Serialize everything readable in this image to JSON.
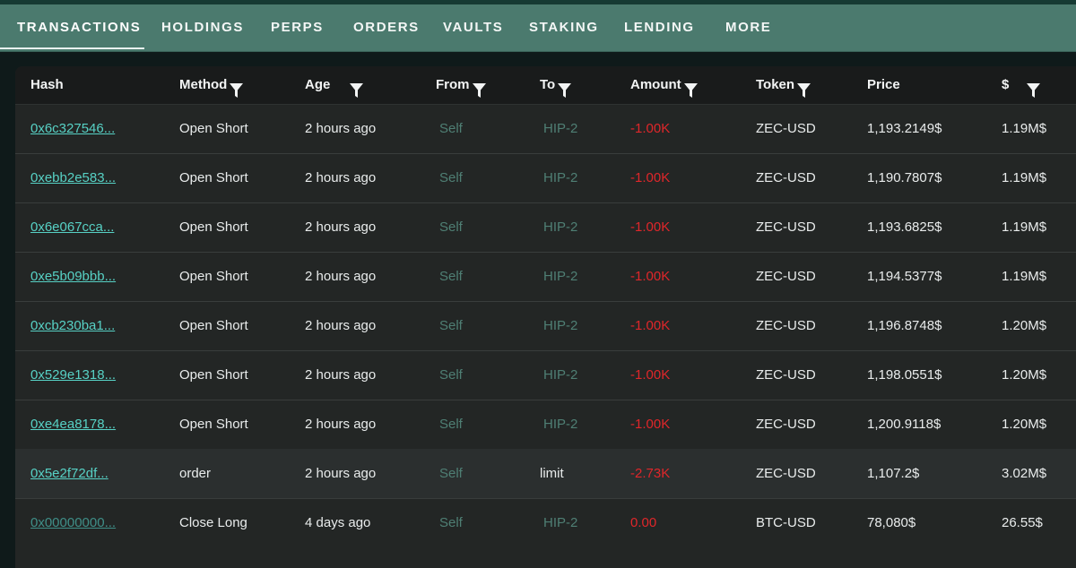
{
  "tabs": [
    {
      "label": "TRANSACTIONS",
      "active": true
    },
    {
      "label": "HOLDINGS"
    },
    {
      "label": "PERPS"
    },
    {
      "label": "ORDERS"
    },
    {
      "label": "VAULTS"
    },
    {
      "label": "STAKING"
    },
    {
      "label": "LENDING"
    },
    {
      "label": "MORE"
    }
  ],
  "table": {
    "columns": [
      {
        "label": "Hash",
        "filter": false
      },
      {
        "label": "Method",
        "filter": true
      },
      {
        "label": "Age",
        "filter": true
      },
      {
        "label": "From",
        "filter": true
      },
      {
        "label": "To",
        "filter": true
      },
      {
        "label": "Amount",
        "filter": true
      },
      {
        "label": "Token",
        "filter": true
      },
      {
        "label": "Price",
        "filter": false
      },
      {
        "label": "$",
        "filter": true
      }
    ],
    "rows": [
      {
        "hash": "0x6c327546...",
        "method": "Open Short",
        "age": "2 hours ago",
        "from": "Self",
        "to": "HIP-2",
        "amount": "-1.00K",
        "token": "ZEC-USD",
        "price": "1,193.2149$",
        "usd": "1.19M$"
      },
      {
        "hash": "0xebb2e583...",
        "method": "Open Short",
        "age": "2 hours ago",
        "from": "Self",
        "to": "HIP-2",
        "amount": "-1.00K",
        "token": "ZEC-USD",
        "price": "1,190.7807$",
        "usd": "1.19M$"
      },
      {
        "hash": "0x6e067cca...",
        "method": "Open Short",
        "age": "2 hours ago",
        "from": "Self",
        "to": "HIP-2",
        "amount": "-1.00K",
        "token": "ZEC-USD",
        "price": "1,193.6825$",
        "usd": "1.19M$"
      },
      {
        "hash": "0xe5b09bbb...",
        "method": "Open Short",
        "age": "2 hours ago",
        "from": "Self",
        "to": "HIP-2",
        "amount": "-1.00K",
        "token": "ZEC-USD",
        "price": "1,194.5377$",
        "usd": "1.19M$"
      },
      {
        "hash": "0xcb230ba1...",
        "method": "Open Short",
        "age": "2 hours ago",
        "from": "Self",
        "to": "HIP-2",
        "amount": "-1.00K",
        "token": "ZEC-USD",
        "price": "1,196.8748$",
        "usd": "1.20M$"
      },
      {
        "hash": "0x529e1318...",
        "method": "Open Short",
        "age": "2 hours ago",
        "from": "Self",
        "to": "HIP-2",
        "amount": "-1.00K",
        "token": "ZEC-USD",
        "price": "1,198.0551$",
        "usd": "1.20M$"
      },
      {
        "hash": "0xe4ea8178...",
        "method": "Open Short",
        "age": "2 hours ago",
        "from": "Self",
        "to": "HIP-2",
        "amount": "-1.00K",
        "token": "ZEC-USD",
        "price": "1,200.9118$",
        "usd": "1.20M$"
      },
      {
        "hash": "0x5e2f72df...",
        "method": "order",
        "age": "2 hours ago",
        "from": "Self",
        "to": "limit",
        "amount": "-2.73K",
        "token": "ZEC-USD",
        "price": "1,107.2$",
        "usd": "3.02M$"
      },
      {
        "hash": "0x00000000...",
        "method": "Close Long",
        "age": "4 days ago",
        "from": "Self",
        "to": "HIP-2",
        "amount": "0.00",
        "token": "BTC-USD",
        "price": "78,080$",
        "usd": "26.55$"
      }
    ]
  },
  "colors": {
    "tabbar": "#4b7a6e",
    "link": "#57d1c5",
    "negative": "#e0262a",
    "muted": "#4f7f74"
  }
}
